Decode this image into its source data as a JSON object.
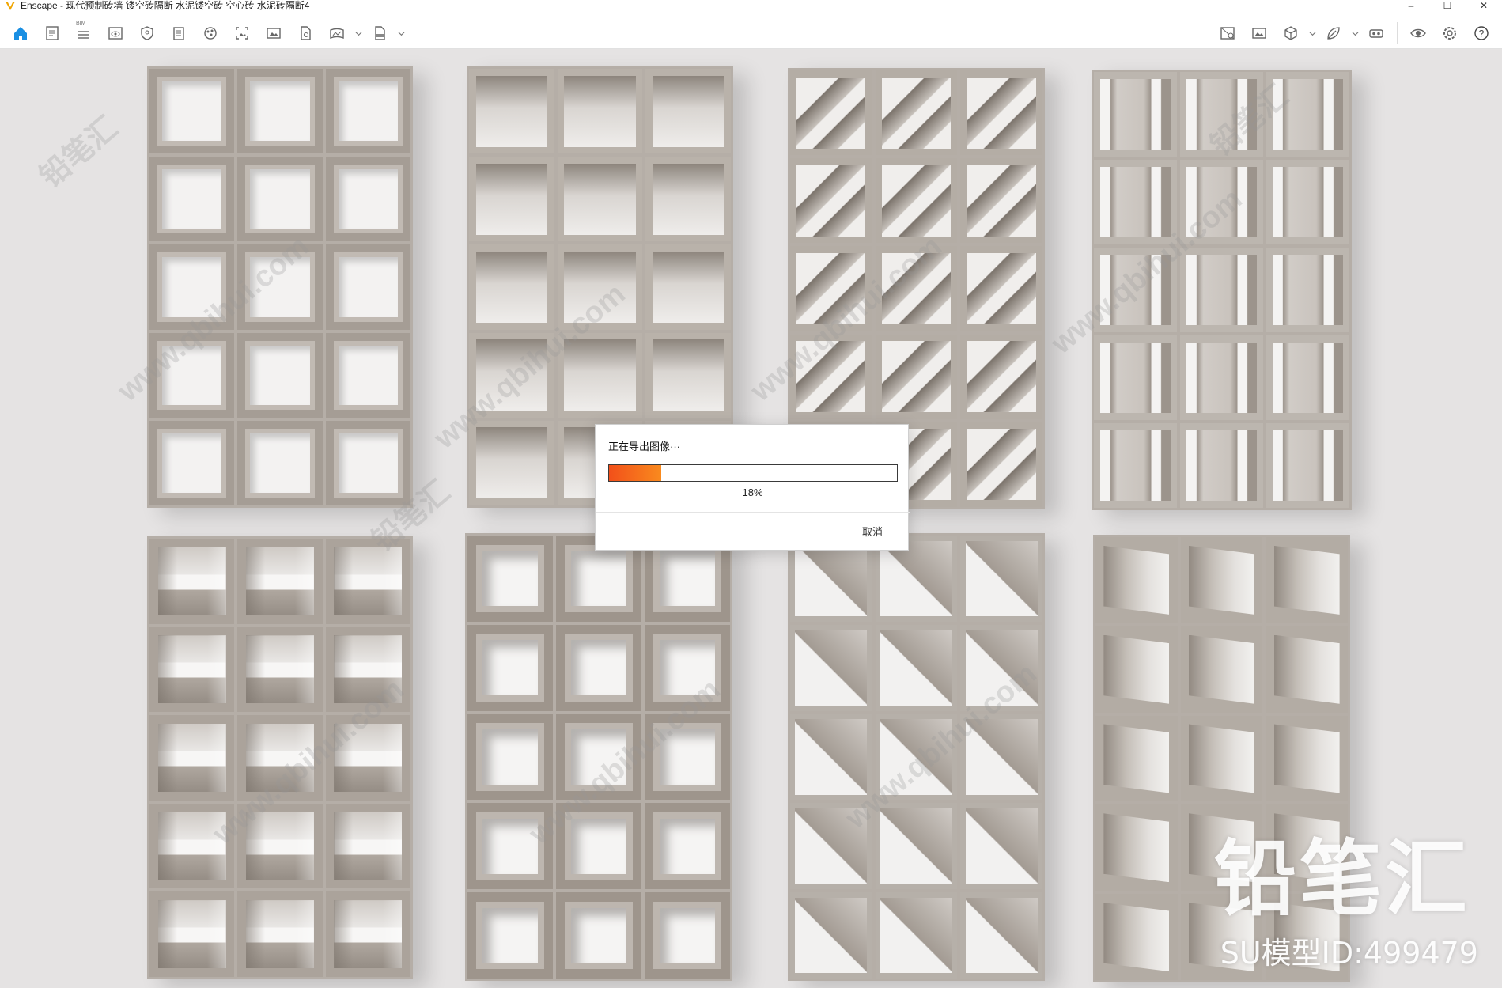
{
  "window": {
    "title": "Enscape - 现代预制砖墙 镂空砖隔断 水泥镂空砖 空心砖 水泥砖隔断4",
    "minimize": "–",
    "maximize": "☐",
    "close": "✕"
  },
  "toolbar": {
    "bim_label": "BIM",
    "left_icons": [
      "home-icon",
      "document-icon",
      "list-icon",
      "eye-icon",
      "shield-icon",
      "building-icon",
      "globe-icon",
      "image-crop-icon",
      "image-icon",
      "file-settings-icon",
      "panorama-icon",
      "exe-export-icon"
    ],
    "right_icons": [
      "map-pin-icon",
      "image-gallery-icon",
      "cube-icon",
      "leaf-icon",
      "vr-headset-icon",
      "visibility-icon",
      "settings-icon",
      "help-icon"
    ],
    "help_label": "?"
  },
  "dialog": {
    "title": "正在导出图像···",
    "progress": 18,
    "progress_text": "18%",
    "cancel_label": "取消",
    "accent": "#f2501a"
  },
  "watermark": {
    "brand": "铅笔汇",
    "id_text": "SU模型ID:499479",
    "site": "www.qbihui.com",
    "stamp": "铅笔汇"
  }
}
